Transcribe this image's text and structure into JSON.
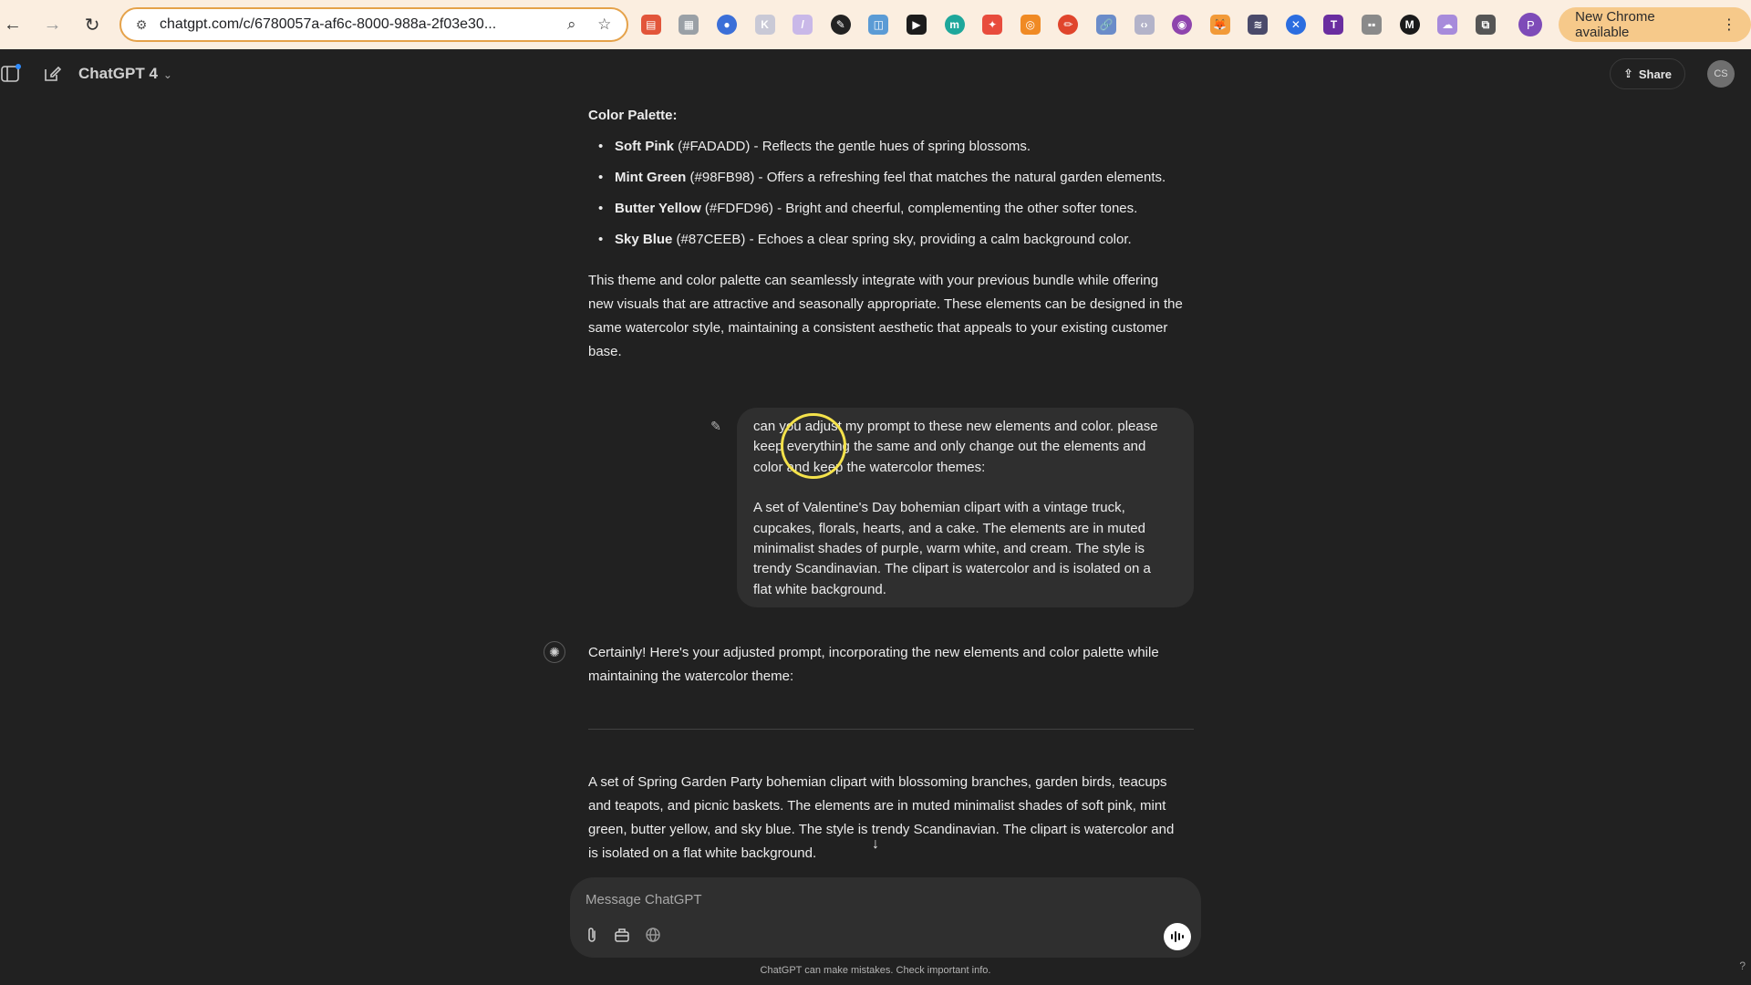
{
  "browser": {
    "url": "chatgpt.com/c/6780057a-af6c-8000-988a-2f03e30...",
    "profile_initial": "P",
    "update_label": "New Chrome available"
  },
  "header": {
    "model_title": "ChatGPT 4",
    "share_label": "Share",
    "user_initials": "CS"
  },
  "messages": {
    "palette_heading": "Color Palette:",
    "palette": [
      {
        "name": "Soft Pink",
        "detail": " (#FADADD) - Reflects the gentle hues of spring blossoms."
      },
      {
        "name": "Mint Green",
        "detail": " (#98FB98) - Offers a refreshing feel that matches the natural garden elements."
      },
      {
        "name": "Butter Yellow",
        "detail": " (#FDFD96) - Bright and cheerful, complementing the other softer tones."
      },
      {
        "name": "Sky Blue",
        "detail": " (#87CEEB) - Echoes a clear spring sky, providing a calm background color."
      }
    ],
    "summary_lines": [
      "This theme and color palette can seamlessly integrate with your previous bundle while offering",
      "new visuals that are attractive and seasonally appropriate. These elements can be designed in the",
      "same watercolor style, maintaining a consistent aesthetic that appeals to your existing customer",
      "base."
    ],
    "user_lines_1": [
      "can you adjust my prompt to these new elements and color. please",
      "keep everything the same and only change out the elements and",
      "color and keep the watercolor themes:"
    ],
    "user_lines_2": [
      "A set of Valentine's Day bohemian clipart with a vintage truck,",
      "cupcakes, florals, hearts, and a cake. The elements are in muted",
      "minimalist shades of purple, warm white, and cream. The style is",
      "trendy Scandinavian. The clipart is watercolor and is isolated on a",
      "flat white background."
    ],
    "assistant_intro_lines": [
      "Certainly! Here's your adjusted prompt, incorporating the new elements and color palette while",
      "maintaining the watercolor theme:"
    ],
    "assistant_prompt_lines": [
      "A set of Spring Garden Party bohemian clipart with blossoming branches, garden birds, teacups",
      "and teapots, and picnic baskets. The elements are in muted minimalist shades of soft pink, mint",
      "green, butter yellow, and sky blue. The style is trendy Scandinavian. The clipart is watercolor and",
      "is isolated on a flat white background."
    ]
  },
  "composer": {
    "placeholder": "Message ChatGPT",
    "value": ""
  },
  "footer": {
    "disclaimer": "ChatGPT can make mistakes. Check important info.",
    "help": "?"
  },
  "icons": {
    "extensions": [
      {
        "name": "extension-red-icon",
        "color": "#e2553a",
        "glyph": "▤"
      },
      {
        "name": "extension-gray-doc-icon",
        "color": "#9aa0a6",
        "glyph": "▦"
      },
      {
        "name": "extension-blue-circle-icon",
        "color": "#3b6fd8",
        "glyph": "●"
      },
      {
        "name": "extension-k-icon",
        "color": "#c9c9d6",
        "glyph": "K"
      },
      {
        "name": "extension-pen-icon",
        "color": "#c9b8e8",
        "glyph": "/"
      },
      {
        "name": "extension-eyedropper-icon",
        "color": "#222222",
        "glyph": "✎"
      },
      {
        "name": "extension-blue-square-icon",
        "color": "#5b9bd5",
        "glyph": "◫"
      },
      {
        "name": "extension-play-icon",
        "color": "#1c1c1c",
        "glyph": "▶"
      },
      {
        "name": "extension-teal-circle-icon",
        "color": "#1ea79b",
        "glyph": "m"
      },
      {
        "name": "extension-multicolor-icon",
        "color": "#e84c3d",
        "glyph": "✦"
      },
      {
        "name": "extension-orange-ring-icon",
        "color": "#f08a24",
        "glyph": "◎"
      },
      {
        "name": "extension-red-pencil-icon",
        "color": "#e0452c",
        "glyph": "✏"
      },
      {
        "name": "extension-link-icon",
        "color": "#6b8cc9",
        "glyph": "🔗"
      },
      {
        "name": "extension-code-icon",
        "color": "#b3b3c9",
        "glyph": "‹›"
      },
      {
        "name": "extension-eye-icon",
        "color": "#8e44ad",
        "glyph": "◉"
      },
      {
        "name": "extension-fox-icon",
        "color": "#f29a38",
        "glyph": "🦊"
      },
      {
        "name": "extension-layers-icon",
        "color": "#4a4a6a",
        "glyph": "≋"
      },
      {
        "name": "extension-blue-x-icon",
        "color": "#2b6de0",
        "glyph": "✕"
      },
      {
        "name": "extension-t-icon",
        "color": "#6a2ea0",
        "glyph": "T"
      },
      {
        "name": "extension-grid-icon",
        "color": "#8a8a8a",
        "glyph": "▪▪"
      },
      {
        "name": "extension-m-icon",
        "color": "#1a1a1a",
        "glyph": "M"
      },
      {
        "name": "extension-cloud-icon",
        "color": "#a78bdb",
        "glyph": "☁"
      },
      {
        "name": "extensions-puzzle-icon",
        "color": "#555555",
        "glyph": "⧉"
      }
    ]
  },
  "colors": {
    "background": "#212121",
    "bubble": "#2f2f2f",
    "chrome": "#fbeee0",
    "omnibox_border": "#e5a24a",
    "update_pill": "#f6c98a",
    "cursor_ring": "#f4e24b"
  }
}
